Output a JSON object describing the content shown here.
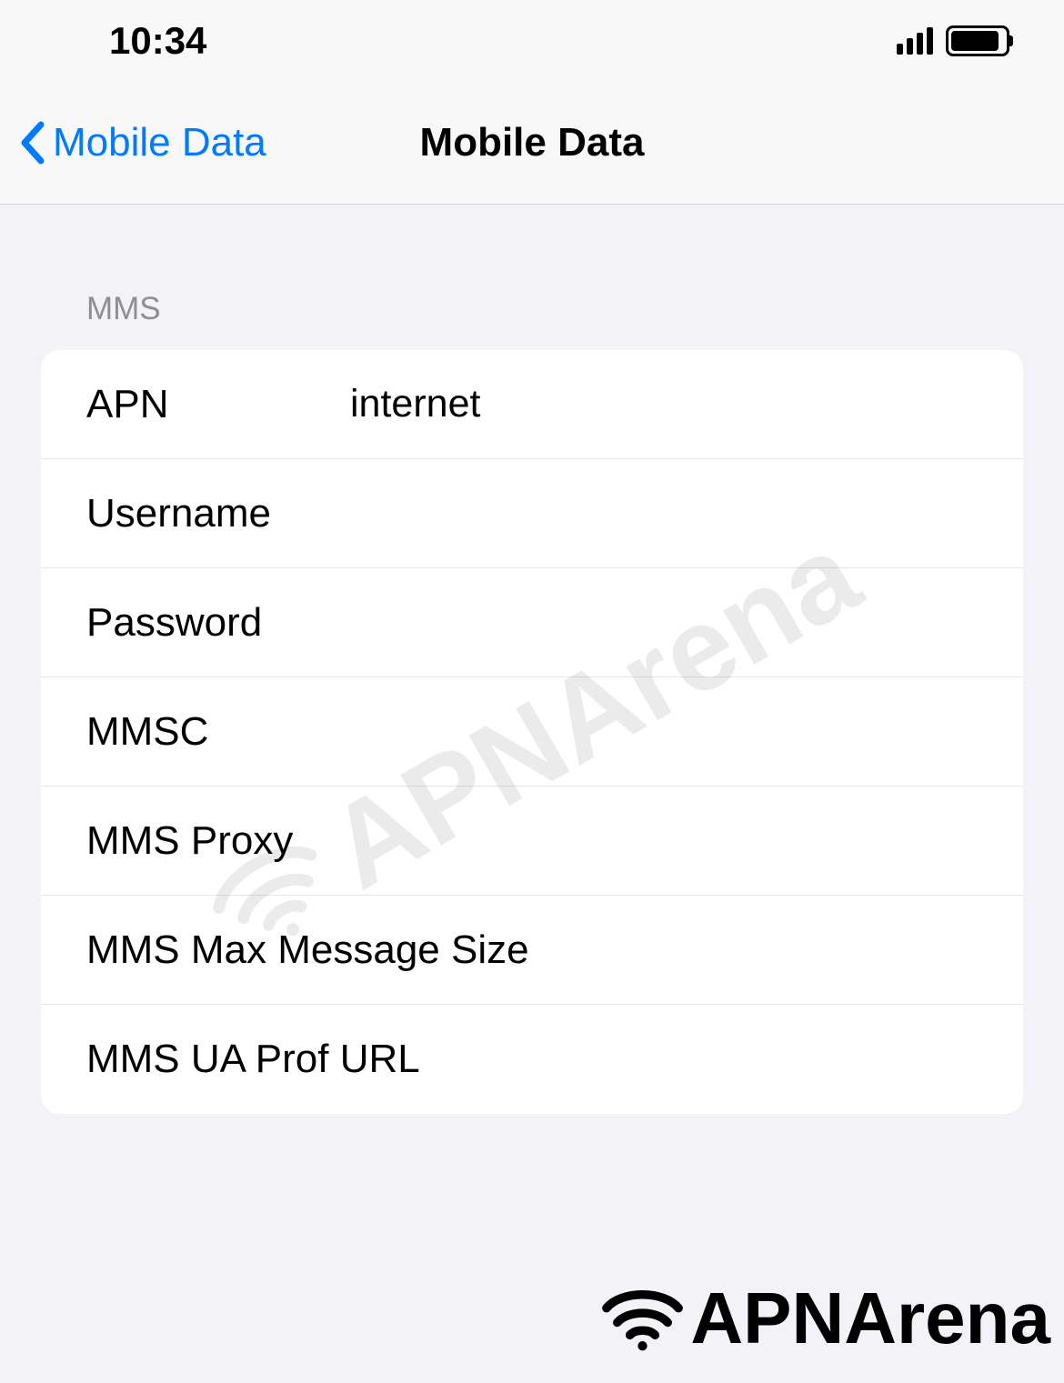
{
  "status_bar": {
    "time": "10:34"
  },
  "nav": {
    "back_label": "Mobile Data",
    "title": "Mobile Data"
  },
  "section": {
    "header": "MMS"
  },
  "fields": {
    "apn": {
      "label": "APN",
      "value": "internet"
    },
    "username": {
      "label": "Username",
      "value": ""
    },
    "password": {
      "label": "Password",
      "value": ""
    },
    "mmsc": {
      "label": "MMSC",
      "value": ""
    },
    "mms_proxy": {
      "label": "MMS Proxy",
      "value": ""
    },
    "mms_max_size": {
      "label": "MMS Max Message Size",
      "value": ""
    },
    "mms_ua_prof": {
      "label": "MMS UA Prof URL",
      "value": ""
    }
  },
  "watermark": {
    "text": "APNArena"
  },
  "footer": {
    "brand": "APNArena"
  }
}
